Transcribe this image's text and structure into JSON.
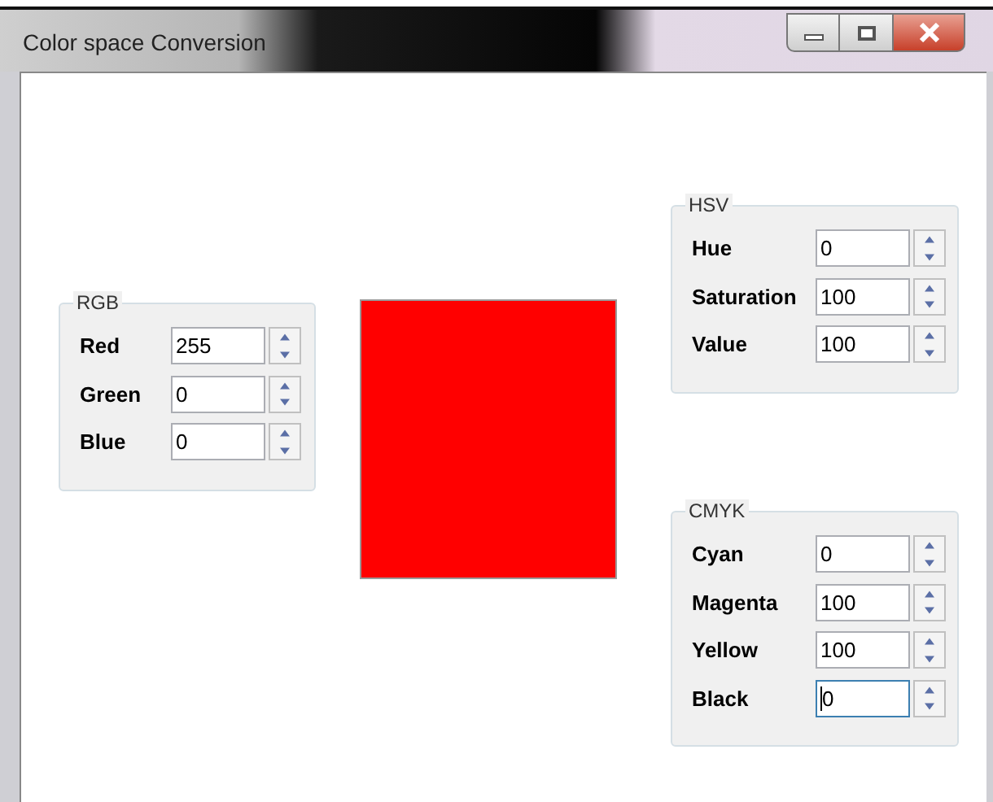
{
  "window": {
    "title": "Color space Conversion"
  },
  "groups": [
    {
      "title": "RGB",
      "fields": [
        {
          "label": "Red",
          "value": "255",
          "focused": false
        },
        {
          "label": "Green",
          "value": "0",
          "focused": false
        },
        {
          "label": "Blue",
          "value": "0",
          "focused": false
        }
      ]
    },
    {
      "title": "HSV",
      "fields": [
        {
          "label": "Hue",
          "value": "0",
          "focused": false
        },
        {
          "label": "Saturation",
          "value": "100",
          "focused": false
        },
        {
          "label": "Value",
          "value": "100",
          "focused": false
        }
      ]
    },
    {
      "title": "CMYK",
      "fields": [
        {
          "label": "Cyan",
          "value": "0",
          "focused": false
        },
        {
          "label": "Magenta",
          "value": "100",
          "focused": false
        },
        {
          "label": "Yellow",
          "value": "100",
          "focused": false
        },
        {
          "label": "Black",
          "value": "0",
          "focused": true
        }
      ]
    }
  ]
}
